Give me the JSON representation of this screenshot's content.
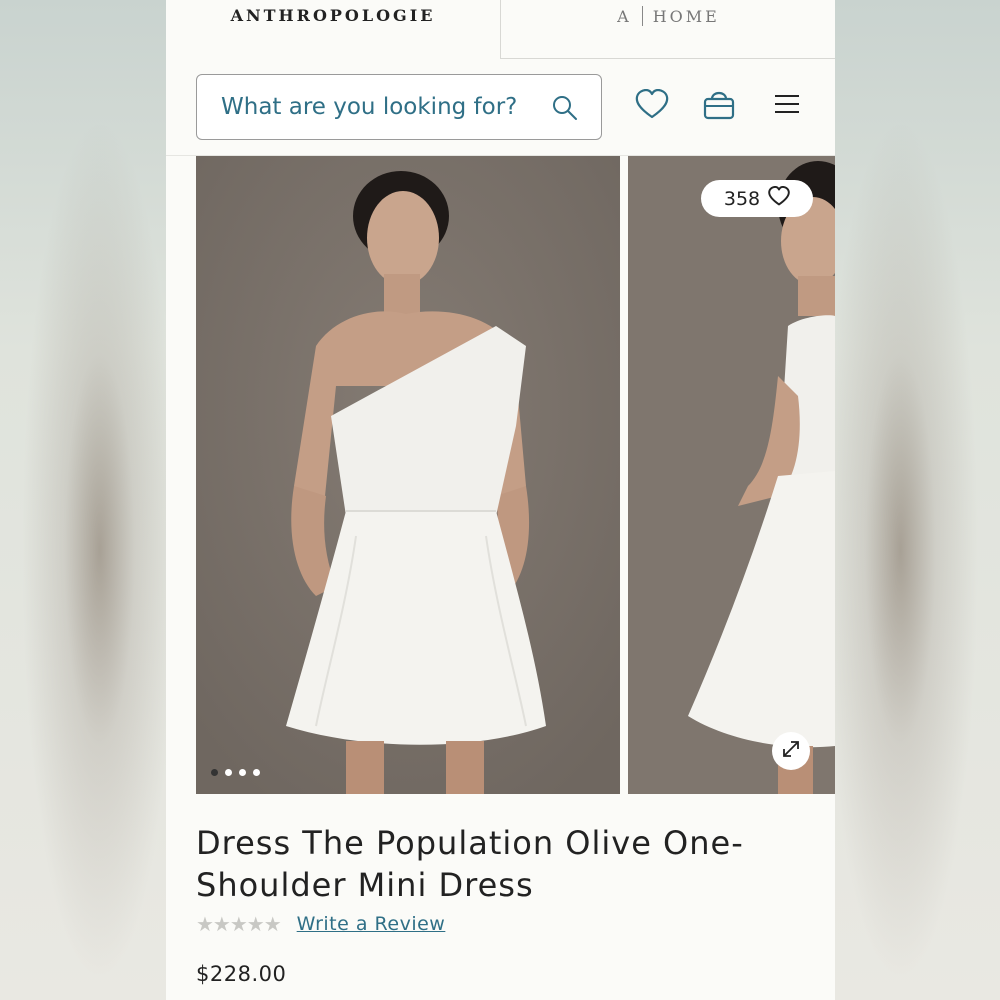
{
  "header": {
    "brand": "ANTHROPOLOGIE",
    "home_tab_letter": "A",
    "home_tab_label": "HOME"
  },
  "search": {
    "placeholder": "What are you looking for?"
  },
  "icons": [
    "search-icon",
    "heart-icon",
    "bag-icon",
    "menu-icon",
    "expand-icon"
  ],
  "gallery": {
    "like_count": "358",
    "dot_count": 4,
    "active_dot": 0
  },
  "product": {
    "title_line1": "Dress The Population Olive One-",
    "title_line2": "Shoulder Mini Dress",
    "rating": 0,
    "review_link": "Write a Review",
    "price": "$228.00"
  },
  "colors": {
    "accent": "#2f6f86",
    "text": "#222222",
    "background": "#fbfbf8",
    "photo_backdrop": "#7a7169"
  }
}
